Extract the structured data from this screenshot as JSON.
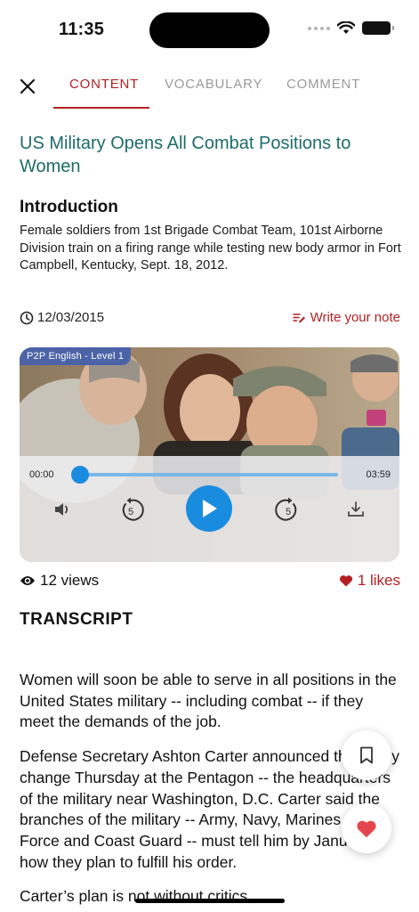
{
  "status_bar": {
    "time": "11:35"
  },
  "tabs": [
    {
      "label": "CONTENT",
      "active": true
    },
    {
      "label": "VOCABULARY",
      "active": false
    },
    {
      "label": "COMMENT",
      "active": false
    }
  ],
  "article": {
    "title": "US Military Opens All Combat Positions to Women",
    "section_heading": "Introduction",
    "intro": "Female soldiers from 1st Brigade Combat Team, 101st Airborne Division train on a firing range while testing new body armor in Fort Campbell, Kentucky, Sept. 18, 2012.",
    "date": "12/03/2015",
    "note_label": "Write your note"
  },
  "player": {
    "level_badge": "P2P English - Level 1",
    "current_time": "00:00",
    "total_time": "03:59",
    "progress": 0.0,
    "rewind_seconds": "5",
    "forward_seconds": "5"
  },
  "stats": {
    "views": "12 views",
    "likes": "1 likes"
  },
  "transcript": {
    "heading": "TRANSCRIPT",
    "paragraphs": [
      "Women will soon be able to serve in all positions in the United States military -- including combat -- if they meet the demands of the job.",
      "Defense Secretary Ashton Carter announced the policy change Thursday at the Pentagon -- the headquarters of the military near Washington, D.C. Carter said the branches of the military -- Army, Navy, Marines, Air Force and Coast Guard -- must tell him by January how they plan to fulfill his order.",
      "Carter’s plan is not without critics."
    ]
  },
  "colors": {
    "accent": "#b32024",
    "title": "#1e6b6b",
    "player_blue": "#1a8ce0",
    "badge": "#4d63a8"
  },
  "icons": [
    "close-icon",
    "clock-icon",
    "edit-note-icon",
    "volume-icon",
    "rewind-5-icon",
    "play-icon",
    "forward-5-icon",
    "download-icon",
    "eye-icon",
    "heart-icon",
    "bookmark-icon"
  ]
}
